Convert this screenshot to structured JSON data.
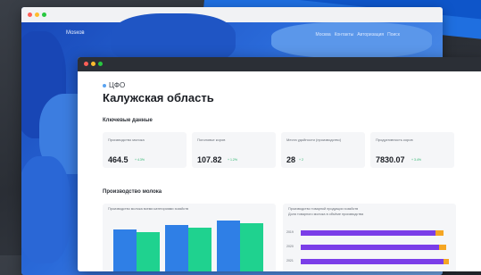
{
  "colors": {
    "accent_blue": "#2f7fe6",
    "accent_green": "#1fd28f",
    "accent_purple": "#7a3de8",
    "accent_orange": "#f5a623"
  },
  "map_window": {
    "region_label": "Моsков",
    "links": [
      "Москва",
      "Контакты",
      "Авторизация",
      "Поиск"
    ]
  },
  "dashboard": {
    "breadcrumb": "ЦФО",
    "title": "Калужская область",
    "key_data_heading": "Ключевые данные",
    "cards": [
      {
        "label": "Производство молока",
        "value": "464.5",
        "delta": "+ 4.3%"
      },
      {
        "label": "Поголовье коров",
        "value": "107.82",
        "delta": "+ 1.2%"
      },
      {
        "label": "Места удойности (производство)",
        "value": "28",
        "delta": "+ 2"
      },
      {
        "label": "Продуктивность коров",
        "value": "7830.07",
        "delta": "+ 3.4%"
      }
    ],
    "milk_heading": "Производство молока",
    "left_panel_label": "Производство молока всеми категориями хозяйств",
    "right_panel_label": "Производство товарной продукции хозяйств",
    "right_panel_sublabel": "Доля товарного молока в объёме производства",
    "hbar_labels": [
      "2019",
      "2020",
      "2021"
    ]
  },
  "chart_data": [
    {
      "type": "bar",
      "categories": [
        "",
        "",
        ""
      ],
      "series": [
        {
          "values": [
            0.78,
            0.85,
            0.92
          ]
        },
        {
          "values": [
            0.72,
            0.8,
            0.88
          ]
        }
      ]
    },
    {
      "type": "bar",
      "categories": [
        "2019",
        "2020",
        "2021"
      ],
      "series": [
        {
          "values": [
            0.9,
            0.92,
            0.95
          ]
        },
        {
          "values": [
            0.05,
            0.05,
            0.04
          ]
        }
      ]
    }
  ]
}
